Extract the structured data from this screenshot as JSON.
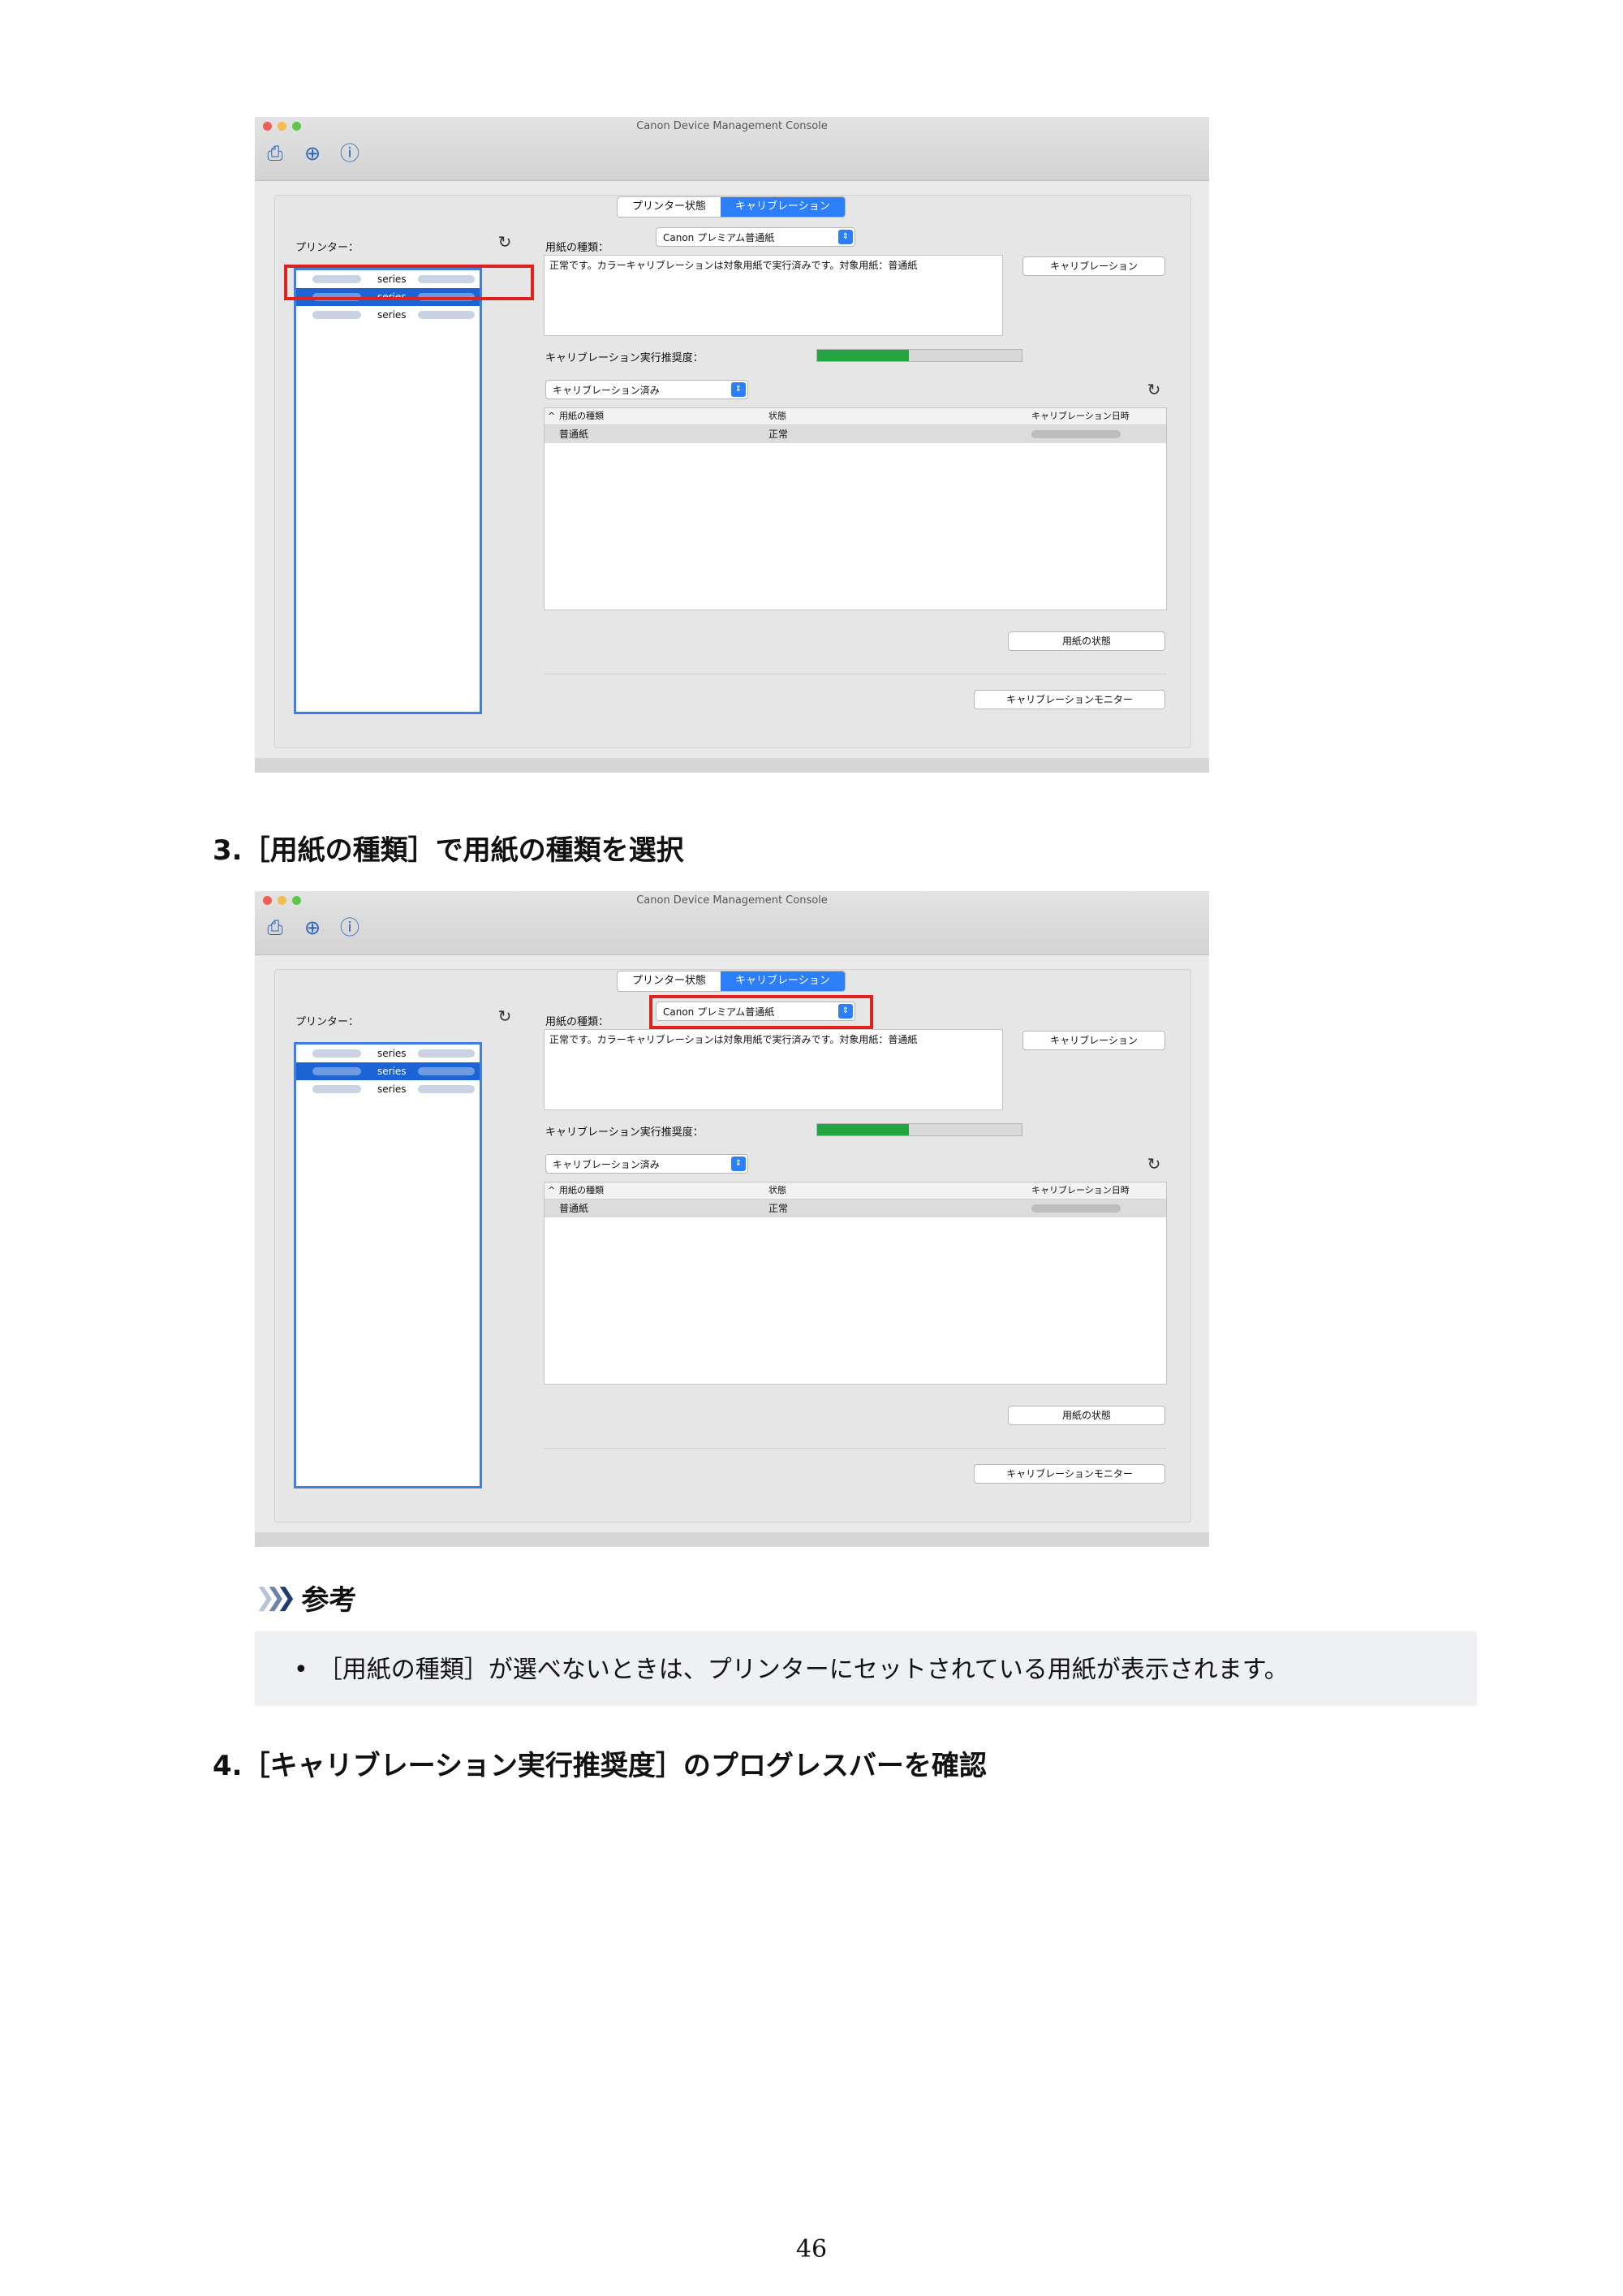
{
  "screenshot": {
    "window_title": "Canon Device Management Console",
    "tabs": [
      "プリンター状態",
      "キャリブレーション"
    ],
    "active_tab": 1,
    "printers_label": "プリンター：",
    "printers": [
      {
        "name": "series",
        "selected": false
      },
      {
        "name": "series",
        "selected": true
      },
      {
        "name": "series",
        "selected": false
      }
    ],
    "media_type_label": "用紙の種類：",
    "media_type_value": "Canon プレミアム普通紙",
    "status_message": "正常です。カラーキャリブレーションは対象用紙で実行済みです。対象用紙：普通紙",
    "calibration_button": "キャリブレーション",
    "recommendation_label": "キャリブレーション実行推奨度：",
    "recommendation_fraction": 0.45,
    "filter_value": "キャリブレーション済み",
    "table": {
      "headers": [
        "用紙の種類",
        "状態",
        "キャリブレーション日時"
      ],
      "rows": [
        {
          "media": "普通紙",
          "state": "正常"
        }
      ]
    },
    "paper_status_button": "用紙の状態",
    "calibration_monitor_button": "キャリブレーションモニター",
    "icons": {
      "toolbar": [
        "printer-settings-icon",
        "add-printer-icon",
        "printer-info-icon"
      ],
      "refresh": "refresh-icon",
      "sort": "sort-ascending-icon"
    },
    "highlight_color": "#e0211c",
    "accent_color": "#2d7ff9",
    "progress_color": "#23a544"
  },
  "steps": {
    "step3": "3.［用紙の種類］で用紙の種類を選択",
    "step4": "4.［キャリブレーション実行推奨度］のプログレスバーを確認"
  },
  "note": {
    "heading": "参考",
    "items": [
      "［用紙の種類］が選べないときは、プリンターにセットされている用紙が表示されます。"
    ]
  },
  "page_number": "46"
}
